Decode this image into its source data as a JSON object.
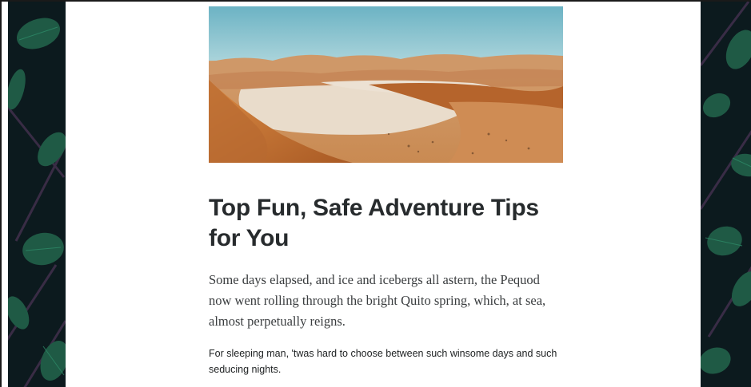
{
  "article": {
    "title": "Top Fun, Safe Adventure Tips for You",
    "lead": "Some days elapsed, and ice and icebergs all astern, the Pequod now went rolling through the bright Quito spring, which, at sea, almost perpetually reigns.",
    "body": "For sleeping man, 'twas hard to choose between such winsome days and such seducing nights."
  },
  "colors": {
    "side_panel_background": "#0c1a1e",
    "leaf_green": "#1f5a45",
    "title_text": "#272b2d",
    "sky": "#7bb9c7",
    "sand": "#d8935a"
  },
  "icons": {
    "hero_image": "desert-dunes-photo",
    "side_pattern": "tropical-leaf-pattern"
  }
}
